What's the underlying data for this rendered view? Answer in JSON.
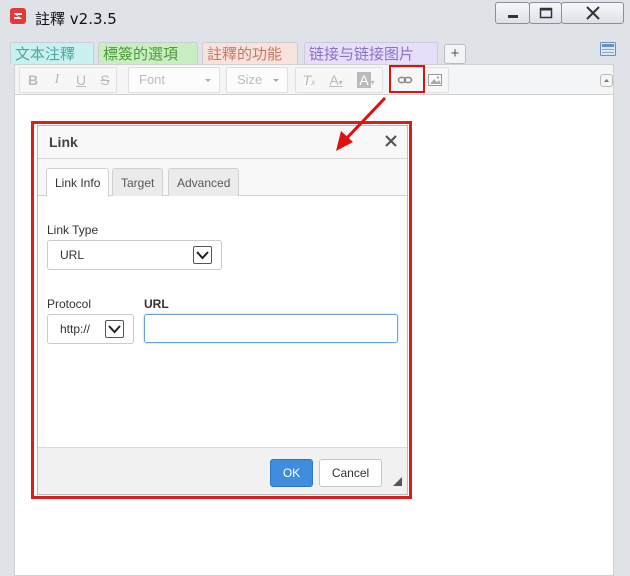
{
  "window": {
    "title": "註釋 v2.3.5",
    "controls": [
      "minimize",
      "maximize",
      "close"
    ]
  },
  "tags": [
    {
      "label": "文本注釋",
      "bg": "#c9f1ef",
      "color": "#4da6a0"
    },
    {
      "label": "標簽的選項",
      "bg": "#c8eec1",
      "color": "#4f9a3c"
    },
    {
      "label": "註釋的功能",
      "bg": "#f7e2dc",
      "color": "#c67a66"
    },
    {
      "label": "链接与链接图片",
      "bg": "#e7defb",
      "color": "#8a72c3"
    }
  ],
  "toolbar": {
    "font_label": "Font",
    "size_label": "Size",
    "link_highlight_color": "#e01010"
  },
  "dialog": {
    "title": "Link",
    "tabs": [
      "Link Info",
      "Target",
      "Advanced"
    ],
    "active_tab": "Link Info",
    "link_type_label": "Link Type",
    "link_type_value": "URL",
    "protocol_label": "Protocol",
    "protocol_value": "http://",
    "url_label": "URL",
    "url_value": "",
    "ok_label": "OK",
    "cancel_label": "Cancel",
    "ok_color": "#3f8ede",
    "highlight_color": "#dd1c1c"
  }
}
